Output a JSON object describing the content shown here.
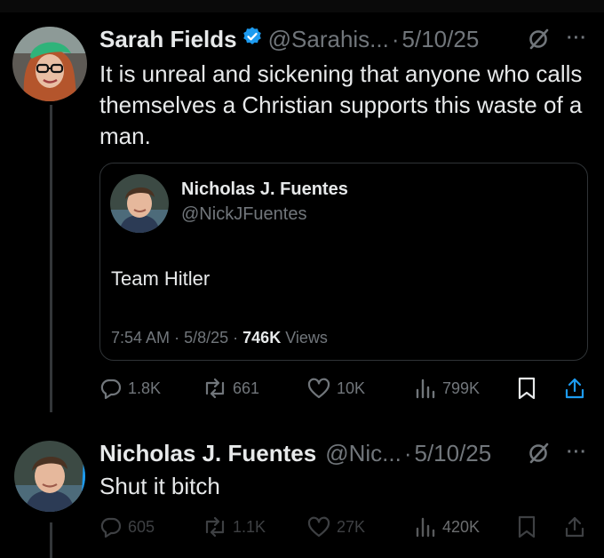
{
  "colors": {
    "background": "#000000",
    "primary_text": "#e7e9ea",
    "secondary_text": "#71767b",
    "verified_blue": "#1d9bf0",
    "border": "#2f3336"
  },
  "post1": {
    "author_name": "Sarah Fields",
    "verified": true,
    "handle": "@Sarahis...",
    "separator": "·",
    "date": "5/10/25",
    "text": "It is unreal and sickening that anyone who calls themselves a Christian supports this waste of a man.",
    "more_label": "···",
    "quoted": {
      "author_name": "Nicholas J. Fuentes",
      "handle": "@NickJFuentes",
      "text": "Team Hitler",
      "time": "7:54 AM",
      "sep1": "·",
      "date": "5/8/25",
      "sep2": "·",
      "views": "746K",
      "views_label": "Views"
    },
    "actions": {
      "replies": "1.8K",
      "reposts": "661",
      "likes": "10K",
      "views": "799K"
    }
  },
  "post2": {
    "author_name": "Nicholas J. Fuentes",
    "handle": "@Nic...",
    "separator": "·",
    "date": "5/10/25",
    "text": "Shut it bitch",
    "more_label": "···",
    "actions": {
      "replies": "605",
      "reposts": "1.1K",
      "likes": "27K",
      "views": "420K"
    }
  },
  "icons": [
    "verified-badge-icon",
    "grok-icon",
    "more-icon",
    "reply-icon",
    "repost-icon",
    "like-icon",
    "views-icon",
    "bookmark-icon",
    "share-icon"
  ]
}
